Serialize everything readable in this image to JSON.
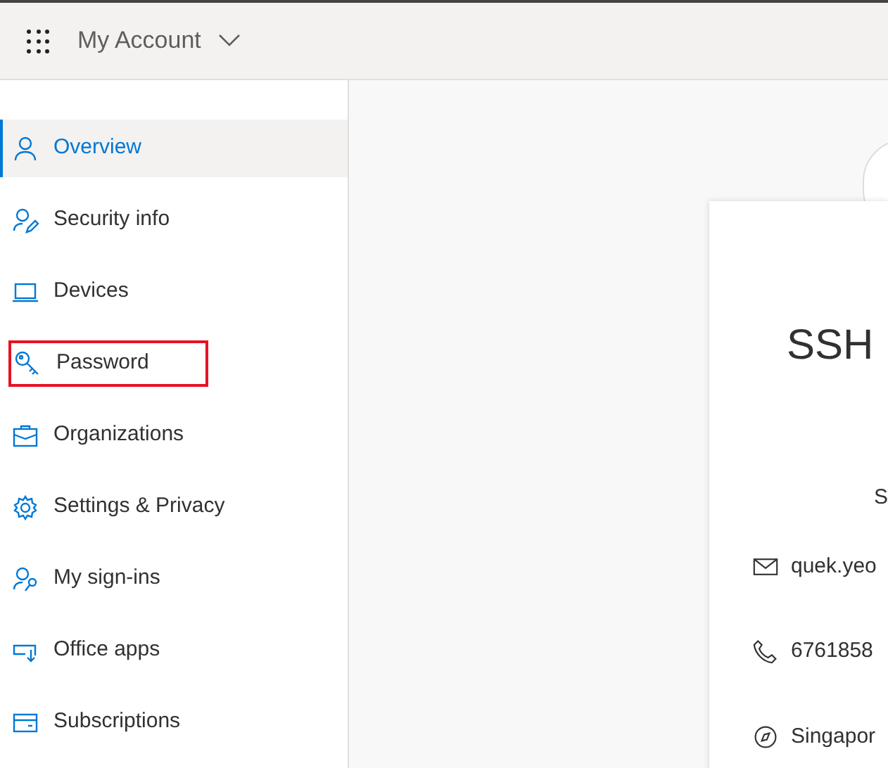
{
  "header": {
    "title": "My Account"
  },
  "sidebar": {
    "items": [
      {
        "label": "Overview",
        "selected": true,
        "highlighted": false,
        "kind": "person"
      },
      {
        "label": "Security info",
        "selected": false,
        "highlighted": false,
        "kind": "person-edit"
      },
      {
        "label": "Devices",
        "selected": false,
        "highlighted": false,
        "kind": "laptop"
      },
      {
        "label": "Password",
        "selected": false,
        "highlighted": true,
        "kind": "key"
      },
      {
        "label": "Organizations",
        "selected": false,
        "highlighted": false,
        "kind": "briefcase"
      },
      {
        "label": "Settings & Privacy",
        "selected": false,
        "highlighted": false,
        "kind": "gear"
      },
      {
        "label": "My sign-ins",
        "selected": false,
        "highlighted": false,
        "kind": "person-key"
      },
      {
        "label": "Office apps",
        "selected": false,
        "highlighted": false,
        "kind": "download"
      },
      {
        "label": "Subscriptions",
        "selected": false,
        "highlighted": false,
        "kind": "card"
      }
    ]
  },
  "profile_card": {
    "name": "SSH",
    "line_2": "S",
    "details": [
      {
        "kind": "email",
        "text": "quek.yeo"
      },
      {
        "kind": "phone",
        "text": "6761858"
      },
      {
        "kind": "location",
        "text": "Singapor"
      }
    ]
  }
}
